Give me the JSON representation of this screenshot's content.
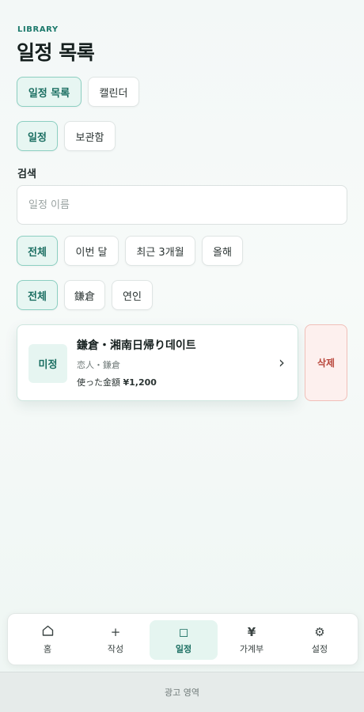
{
  "header": {
    "eyebrow": "LIBRARY",
    "title": "일정 목록"
  },
  "view_tabs": [
    {
      "label": "일정 목록",
      "active": true
    },
    {
      "label": "캘린더",
      "active": false
    }
  ],
  "section_tabs": [
    {
      "label": "일정",
      "active": true
    },
    {
      "label": "보관함",
      "active": false
    }
  ],
  "search": {
    "label": "검색",
    "placeholder": "일정 이름",
    "value": ""
  },
  "period_filters": [
    {
      "label": "전체",
      "active": true
    },
    {
      "label": "이번 달",
      "active": false
    },
    {
      "label": "최근 3개월",
      "active": false
    },
    {
      "label": "올해",
      "active": false
    }
  ],
  "tag_filters": [
    {
      "label": "전체",
      "active": true
    },
    {
      "label": "鎌倉",
      "active": false
    },
    {
      "label": "연인",
      "active": false
    }
  ],
  "plans": [
    {
      "status": "미정",
      "title": "鎌倉・湘南日帰り데이트",
      "subtitle": "恋人・鎌倉",
      "amount_label": "使った金額",
      "amount_value": "¥1,200",
      "delete_label": "삭제"
    }
  ],
  "bottom_nav": [
    {
      "label": "홈",
      "icon": "home-icon",
      "active": false
    },
    {
      "label": "작성",
      "icon": "plus-icon",
      "active": false
    },
    {
      "label": "일정",
      "icon": "square-icon",
      "active": true
    },
    {
      "label": "가계부",
      "icon": "yen-icon",
      "active": false
    },
    {
      "label": "설정",
      "icon": "gear-icon",
      "active": false
    }
  ],
  "ad": {
    "label": "광고 영역"
  },
  "colors": {
    "accent": "#1a6e61",
    "accent_bg": "#e7f6f2",
    "danger": "#b9473c",
    "danger_bg": "#fdf0ee"
  }
}
